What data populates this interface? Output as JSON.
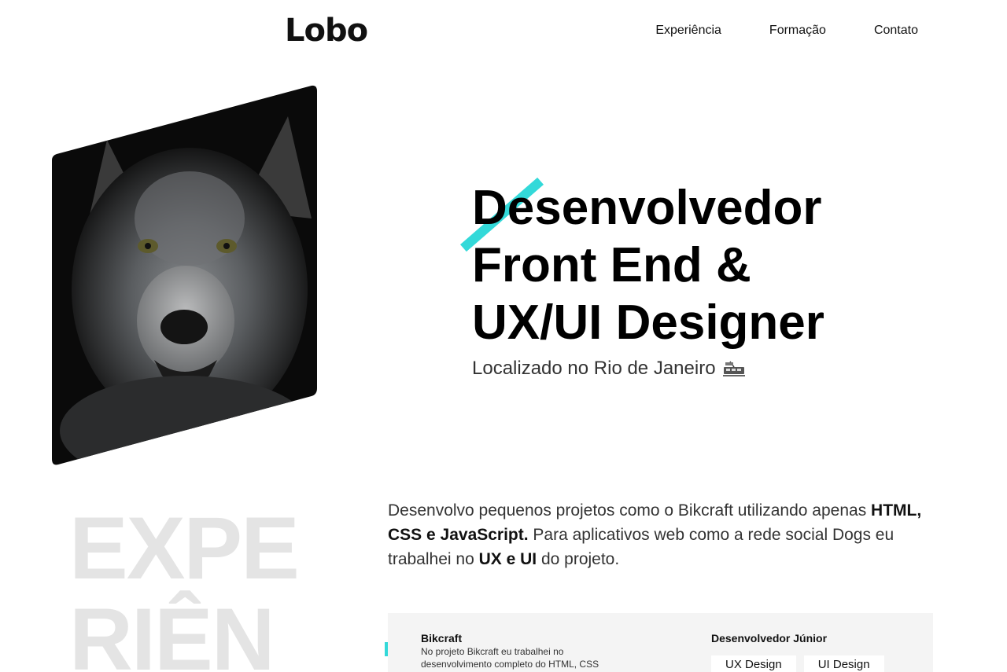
{
  "header": {
    "logo": "Lobo",
    "nav": [
      "Experiência",
      "Formação",
      "Contato"
    ]
  },
  "hero": {
    "title_lines": [
      "Desenvolvedor",
      "Front End &",
      "UX/UI Designer"
    ],
    "subtitle": "Localizado no Rio de Janeiro",
    "location_icon": "tram-icon",
    "accent_color": "#33d9d9"
  },
  "experience": {
    "watermark_lines": [
      "EXPE",
      "RIÊN"
    ],
    "intro_parts": [
      "Desenvolvo pequenos projetos como o Bikcraft utilizando apenas ",
      "HTML, CSS e JavaScript.",
      " Para aplicativos web como a rede social Dogs eu trabalhei no ",
      "UX e UI",
      " do projeto."
    ],
    "card": {
      "project_name": "Bikcraft",
      "project_description": "No projeto Bikcraft eu trabalhei no desenvolvimento completo do HTML, CSS",
      "role": "Desenvolvedor Júnior",
      "tags": [
        "UX Design",
        "UI Design"
      ]
    }
  }
}
